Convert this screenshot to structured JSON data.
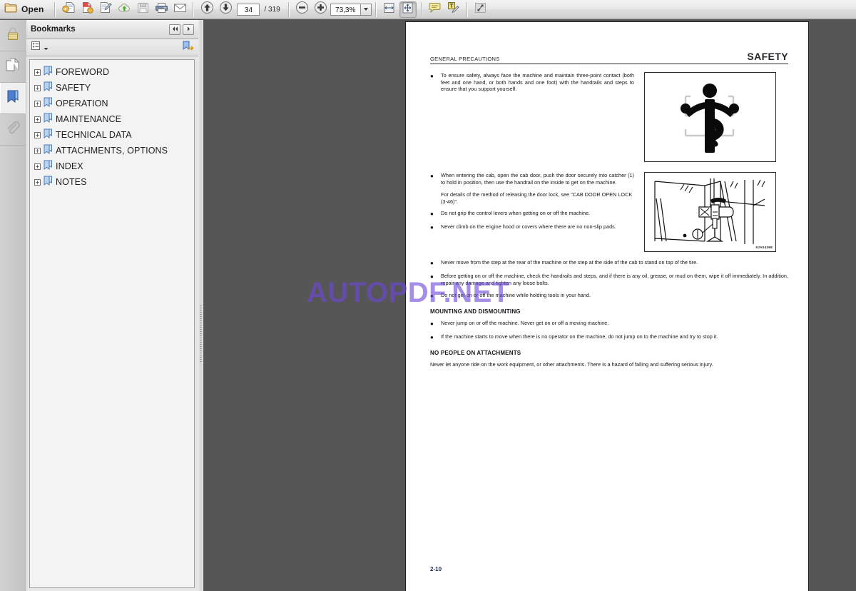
{
  "toolbar": {
    "open_label": "Open",
    "buttons": [
      {
        "name": "open-file-button",
        "icon": "folder-icon",
        "label": "Open"
      },
      {
        "name": "import-document-button",
        "icon": "import-doc-icon"
      },
      {
        "name": "new-document-button",
        "icon": "new-doc-icon"
      },
      {
        "name": "edit-document-button",
        "icon": "edit-doc-icon"
      },
      {
        "name": "upload-cloud-button",
        "icon": "cloud-upload-icon"
      },
      {
        "name": "save-button",
        "icon": "floppy-save-icon"
      },
      {
        "name": "print-button",
        "icon": "printer-icon"
      },
      {
        "name": "email-button",
        "icon": "envelope-icon"
      },
      {
        "name": "previous-page-button",
        "icon": "arrow-up-icon"
      },
      {
        "name": "next-page-button",
        "icon": "arrow-down-icon"
      },
      {
        "name": "zoom-out-button",
        "icon": "minus-circle-icon"
      },
      {
        "name": "zoom-in-button",
        "icon": "plus-circle-icon"
      },
      {
        "name": "fit-width-button",
        "icon": "fit-width-icon"
      },
      {
        "name": "fit-page-button",
        "icon": "fit-page-icon"
      },
      {
        "name": "comment-button",
        "icon": "speech-bubble-icon"
      },
      {
        "name": "highlight-text-button",
        "icon": "highlighter-icon"
      },
      {
        "name": "fullscreen-button",
        "icon": "expand-arrows-icon"
      }
    ],
    "page_current": "34",
    "page_total": "/ 319",
    "zoom_value": "73,3%"
  },
  "rail": {
    "items": [
      {
        "name": "sidebar-tab-security",
        "icon": "lock-icon",
        "active": false
      },
      {
        "name": "sidebar-tab-pages",
        "icon": "pages-icon",
        "active": false
      },
      {
        "name": "sidebar-tab-bookmarks",
        "icon": "bookmark-icon",
        "active": true
      },
      {
        "name": "sidebar-tab-attachments",
        "icon": "paperclip-icon",
        "active": false
      }
    ]
  },
  "bookmarks_panel": {
    "title": "Bookmarks",
    "collapse_icon": "collapse-all-icon",
    "expand_icon": "expand-panel-icon",
    "options_icon": "bookmark-options-icon",
    "add_icon": "add-bookmark-icon",
    "expander_glyph": "+",
    "items": [
      {
        "label": "FOREWORD"
      },
      {
        "label": "SAFETY"
      },
      {
        "label": "OPERATION"
      },
      {
        "label": "MAINTENANCE"
      },
      {
        "label": "TECHNICAL DATA"
      },
      {
        "label": "ATTACHMENTS, OPTIONS"
      },
      {
        "label": "INDEX"
      },
      {
        "label": "NOTES"
      }
    ]
  },
  "document": {
    "header_left": "GENERAL PRECAUTIONS",
    "header_right": "SAFETY",
    "bullet_symbol": "●",
    "block1": {
      "bullet": "To ensure safety, always face the machine and maintain three-point contact (both feet and one hand, or both hands and one foot) with the handrails and steps to ensure that you support yourself.",
      "figure_name": "three-point-contact-figure"
    },
    "block2": {
      "bullet": "When entering the cab, open the cab door, push the door securely into catcher (1) to hold in position, then use the handrail on the inside to get on the machine.",
      "sub_paragraph": "For details of the method of releasing the door lock, see \"CAB DOOR OPEN LOCK (3-46)\".",
      "bullet2": "Do not grip the control levers when getting on or off the machine.",
      "bullet3": "Never climb on the engine hood or covers where there are no non-slip pads.",
      "figure_name": "cab-door-catcher-figure",
      "figure_code": "9JA04398"
    },
    "wide_bullets": [
      "Never move from the step at the rear of the machine or the step at the side of the cab to stand on top of the tire.",
      "Before getting on or off the machine, check the handrails and steps, and if there is any oil, grease, or mud on them, wipe it off immediately.  In addition, repair any damage and tighten any loose bolts.",
      "Do not get on or off the machine while holding tools in your hand."
    ],
    "section1": {
      "heading": "MOUNTING AND DISMOUNTING",
      "bullets": [
        "Never jump on or off the machine. Never get on or off a moving machine.",
        "If the machine starts to move when there is no operator on the machine, do not jump on to the machine and try to stop it."
      ]
    },
    "section2": {
      "heading": "NO PEOPLE ON ATTACHMENTS",
      "paragraph": "Never let anyone ride on the work equipment, or other attachments.  There is a hazard of falling and suffering serious injury."
    },
    "page_number": "2-10"
  },
  "watermark": {
    "text": "AUTOPDF.NET",
    "color": "#6C48D8"
  }
}
